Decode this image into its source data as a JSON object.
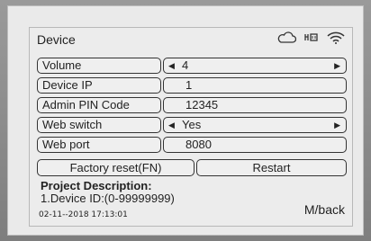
{
  "header": {
    "title": "Device",
    "icons": [
      "cloud-icon",
      "network-port-icon",
      "wifi-icon"
    ]
  },
  "settings": [
    {
      "label": "Volume",
      "value": "4",
      "has_arrows": true
    },
    {
      "label": "Device IP",
      "value": "1",
      "has_arrows": false
    },
    {
      "label": "Admin PIN Code",
      "value": "12345",
      "has_arrows": false
    },
    {
      "label": "Web switch",
      "value": "Yes",
      "has_arrows": true
    },
    {
      "label": "Web port",
      "value": "8080",
      "has_arrows": false
    }
  ],
  "buttons": {
    "factory_reset": "Factory reset(FN)",
    "restart": "Restart"
  },
  "description": {
    "title": "Project Description:",
    "text": "1.Device ID:(0-99999999)"
  },
  "footer": {
    "timestamp": "02-11--2018  17:13:01",
    "back_label": "M/back"
  },
  "glyphs": {
    "left_arrow": "◀",
    "right_arrow": "▶"
  },
  "colors": {
    "bezel": "#8c8c8c",
    "screen": "#ececec",
    "border": "#333333"
  }
}
